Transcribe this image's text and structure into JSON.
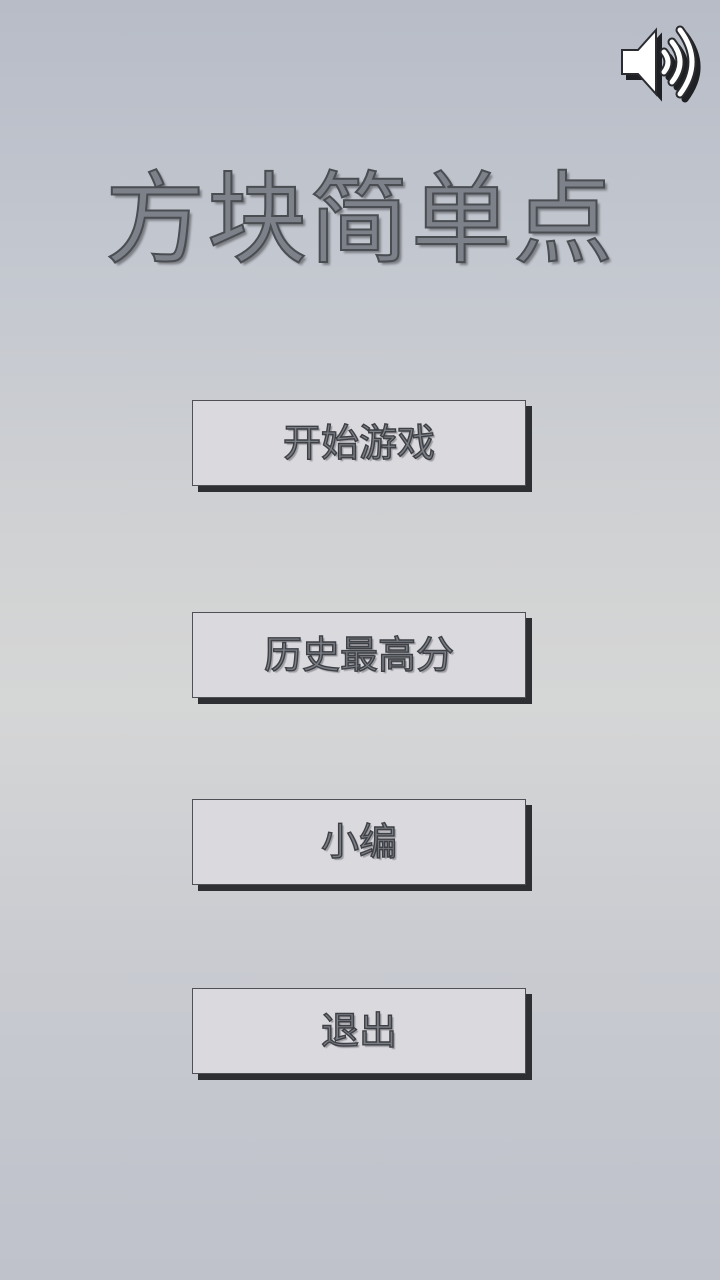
{
  "title": "方块简单点",
  "sound": {
    "icon": "speaker-on-icon",
    "state": "on"
  },
  "menu": {
    "start_label": "开始游戏",
    "highscore_label": "历史最高分",
    "editor_label": "小编",
    "exit_label": "退出"
  },
  "colors": {
    "text_fill": "#7d8189",
    "text_stroke": "#4a4d52",
    "button_bg": "#d9d9de",
    "button_shadow": "#2e2f33"
  }
}
